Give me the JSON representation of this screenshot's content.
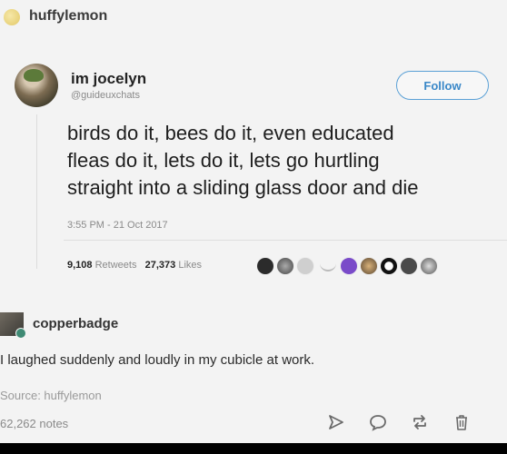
{
  "reblog": {
    "username": "huffylemon"
  },
  "tweet": {
    "name": "im jocelyn",
    "handle": "@guideuxchats",
    "follow_label": "Follow",
    "text_lines": [
      "birds do it, bees do it, even educated",
      "fleas do it, lets do it, lets go hurtling",
      "straight into a sliding glass door and die"
    ],
    "timestamp": "3:55 PM - 21 Oct 2017",
    "retweets_count": "9,108",
    "retweets_label": "Retweets",
    "likes_count": "27,373",
    "likes_label": "Likes"
  },
  "comment": {
    "username": "copperbadge",
    "text": "I laughed suddenly and loudly in my cubicle at work."
  },
  "footer": {
    "source": "Source: huffylemon",
    "notes": "62,262 notes"
  },
  "icons": [
    "share-icon",
    "comment-icon",
    "reblog-icon",
    "delete-icon"
  ],
  "colors": {
    "follow": "#3a88c8",
    "background": "#f3f3f3"
  }
}
